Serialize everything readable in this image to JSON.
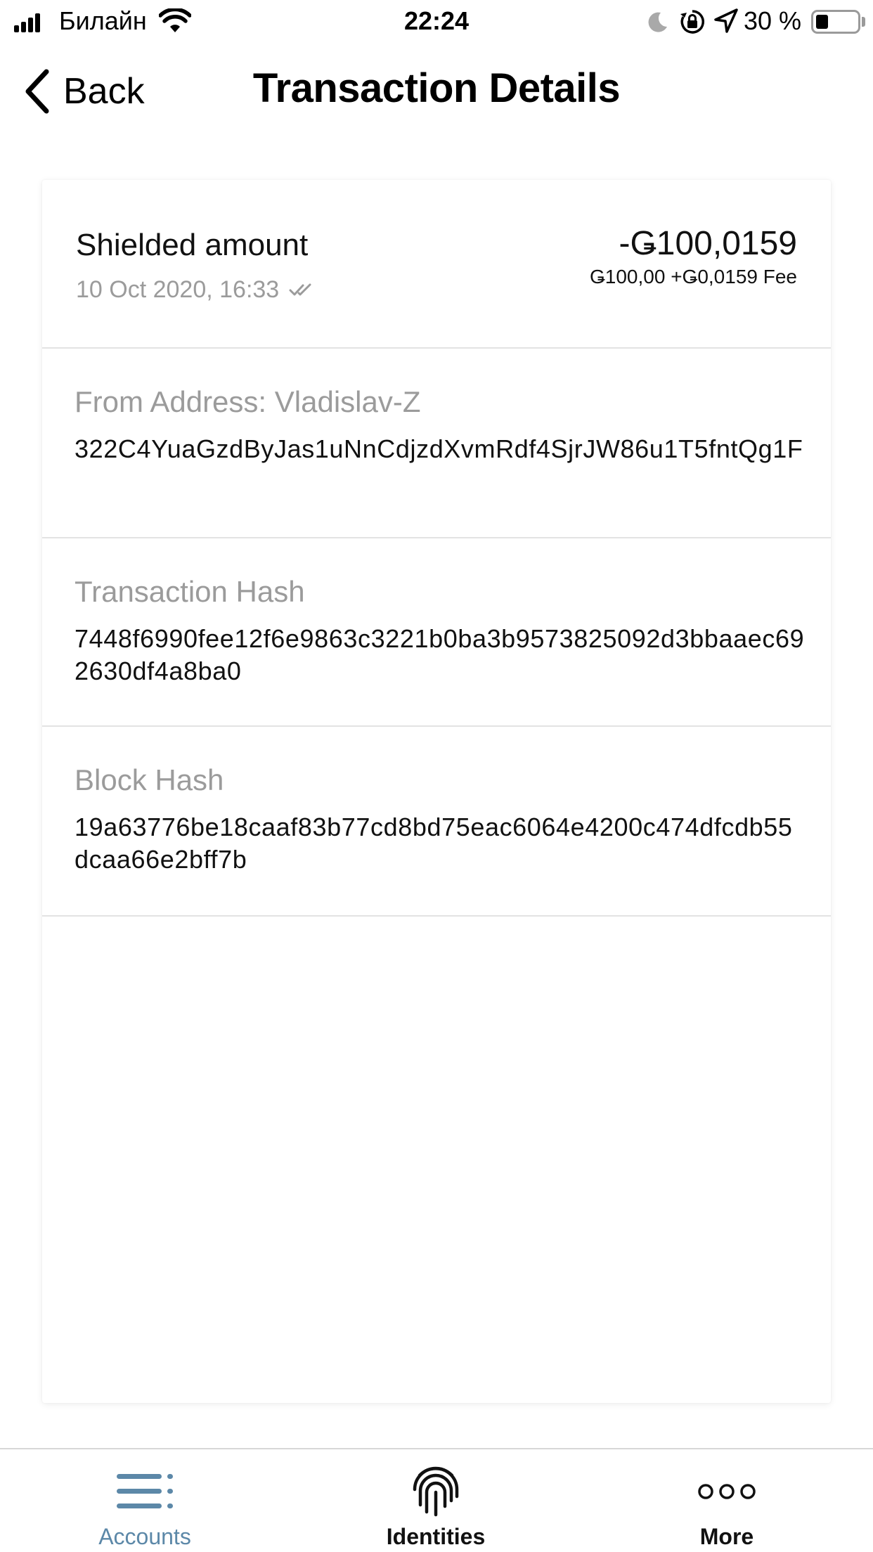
{
  "status_bar": {
    "carrier": "Билайн",
    "time": "22:24",
    "battery_text": "30 %",
    "battery_level": 0.3,
    "icons": [
      "signal-icon",
      "wifi-icon",
      "moon-icon",
      "orientation-lock-icon",
      "location-icon",
      "battery-icon"
    ]
  },
  "nav": {
    "back_label": "Back",
    "title": "Transaction Details"
  },
  "transaction": {
    "title": "Shielded amount",
    "date": "10 Oct 2020, 16:33",
    "amount": "-Ǥ100,0159",
    "fee_breakdown": "Ǥ100,00 +Ǥ0,0159 Fee"
  },
  "details": [
    {
      "label": "From Address: Vladislav-Z",
      "value": "322C4YuaGzdByJas1uNnCdjzdXvmRdf4SjrJW86u1T5fntQg1F"
    },
    {
      "label": "Transaction Hash",
      "value": "7448f6990fee12f6e9863c3221b0ba3b9573825092d3bbaaec692630df4a8ba0"
    },
    {
      "label": "Block Hash",
      "value": "19a63776be18caaf83b77cd8bd75eac6064e4200c474dfcdb55dcaa66e2bff7b"
    }
  ],
  "tab_bar": {
    "tabs": [
      {
        "label": "Accounts",
        "icon": "accounts-list-icon",
        "active": true
      },
      {
        "label": "Identities",
        "icon": "fingerprint-icon",
        "active": false
      },
      {
        "label": "More",
        "icon": "more-dots-icon",
        "active": false
      }
    ]
  },
  "colors": {
    "accent": "#5c88a8",
    "muted_text": "#9b9b9b",
    "divider": "#e3e3e3"
  }
}
